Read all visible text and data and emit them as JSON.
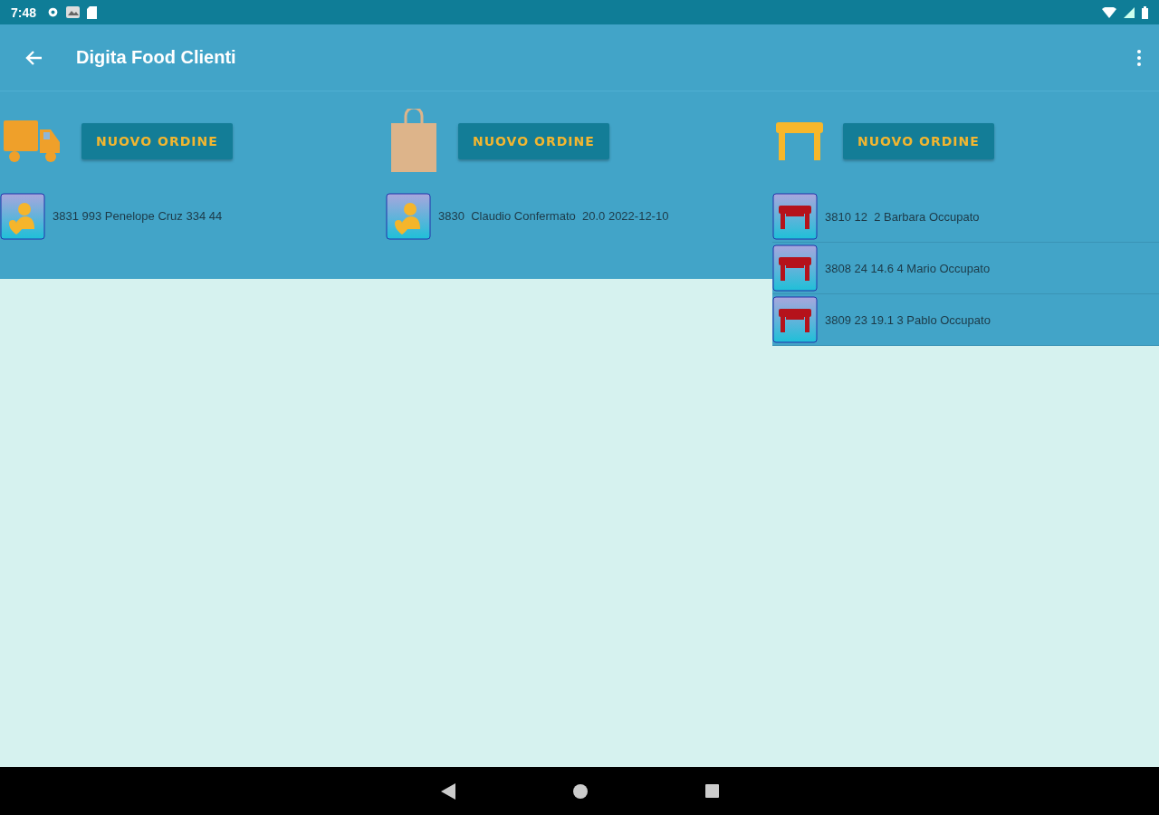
{
  "status_bar": {
    "time": "7:48"
  },
  "app_bar": {
    "title": "Digita Food Clienti"
  },
  "columns": [
    {
      "kind": "delivery",
      "button": "NUOVO ORDINE",
      "orders": [
        {
          "text": "3831 993 Penelope Cruz 334 44"
        }
      ]
    },
    {
      "kind": "takeaway",
      "button": "NUOVO ORDINE",
      "orders": [
        {
          "text": "3830  Claudio Confermato  20.0 2022-12-10"
        }
      ]
    },
    {
      "kind": "table",
      "button": "NUOVO ORDINE",
      "orders": [
        {
          "text": "3810 12  2 Barbara Occupato"
        },
        {
          "text": "3808 24 14.6 4 Mario Occupato"
        },
        {
          "text": "3809 23 19.1 3 Pablo Occupato"
        }
      ]
    }
  ]
}
